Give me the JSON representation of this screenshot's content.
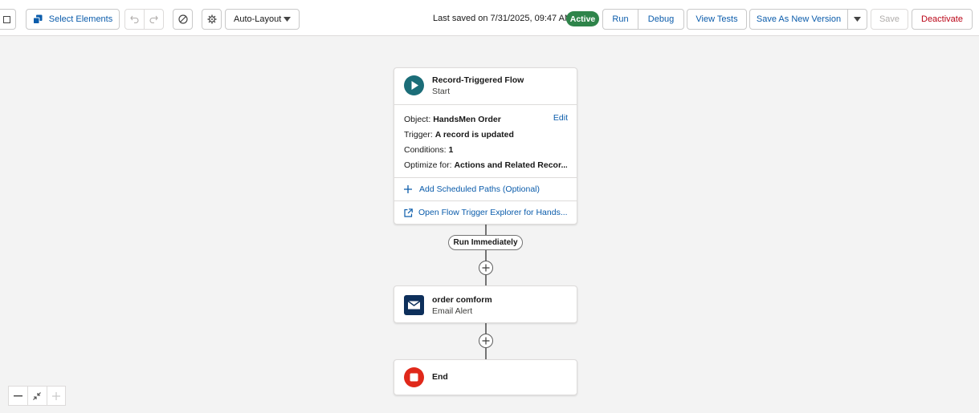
{
  "toolbar": {
    "select_elements_label": "Select Elements",
    "layout_select_value": "Auto-Layout",
    "last_saved_text": "Last saved on 7/31/2025, 09:47 AM",
    "status_badge": "Active",
    "run_label": "Run",
    "debug_label": "Debug",
    "view_tests_label": "View Tests",
    "save_as_new_version_label": "Save As New Version",
    "save_label": "Save",
    "deactivate_label": "Deactivate"
  },
  "start_node": {
    "title": "Record-Triggered Flow",
    "subtitle": "Start",
    "edit_label": "Edit",
    "object_label": "Object:",
    "object_value": "HandsMen Order",
    "trigger_label": "Trigger:",
    "trigger_value": "A record is updated",
    "conditions_label": "Conditions:",
    "conditions_value": "1",
    "optimize_label": "Optimize for:",
    "optimize_value": "Actions and Related Recor...",
    "add_scheduled_paths": "Add Scheduled Paths (Optional)",
    "open_trigger_explorer": "Open Flow Trigger Explorer for Hands..."
  },
  "path_label": "Run Immediately",
  "action_node": {
    "title": "order comform",
    "subtitle": "Email Alert"
  },
  "end_node": {
    "title": "End"
  },
  "icons": {
    "start": "play-icon",
    "email_alert": "envelope-icon",
    "end": "stop-icon"
  },
  "colors": {
    "brand_blue": "#0b5cab",
    "active_green": "#2e844a",
    "start_teal": "#1b6d78",
    "email_navy": "#0d2f5b",
    "end_red": "#e0281a",
    "deactivate_red": "#ba0517"
  }
}
